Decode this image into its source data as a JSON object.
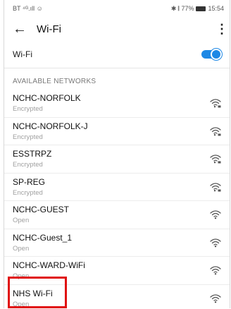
{
  "status_bar": {
    "left": "BT ⁴ᴳ.ıll ☺",
    "right": "✱ 𝄃 77%",
    "time": "15:54"
  },
  "header": {
    "back_icon": "arrow-left-icon",
    "title": "Wi-Fi",
    "more_icon": "more-vertical-icon"
  },
  "wifi_toggle": {
    "label": "Wi-Fi",
    "on": true,
    "accent": "#1e88e5"
  },
  "available": {
    "section_label": "AVAILABLE NETWORKS",
    "networks": [
      {
        "name": "NCHC-NORFOLK",
        "status": "Encrypted",
        "locked": true
      },
      {
        "name": "NCHC-NORFOLK-J",
        "status": "Encrypted",
        "locked": true
      },
      {
        "name": "ESSTRPZ",
        "status": "Encrypted",
        "locked": true
      },
      {
        "name": "SP-REG",
        "status": "Encrypted",
        "locked": true
      },
      {
        "name": "NCHC-GUEST",
        "status": "Open",
        "locked": false
      },
      {
        "name": "NCHC-Guest_1",
        "status": "Open",
        "locked": false
      },
      {
        "name": "NCHC-WARD-WiFi",
        "status": "Open",
        "locked": false
      },
      {
        "name": "NHS Wi-Fi",
        "status": "Open",
        "locked": false,
        "highlighted": true
      }
    ]
  },
  "highlight_color": "#e01010"
}
